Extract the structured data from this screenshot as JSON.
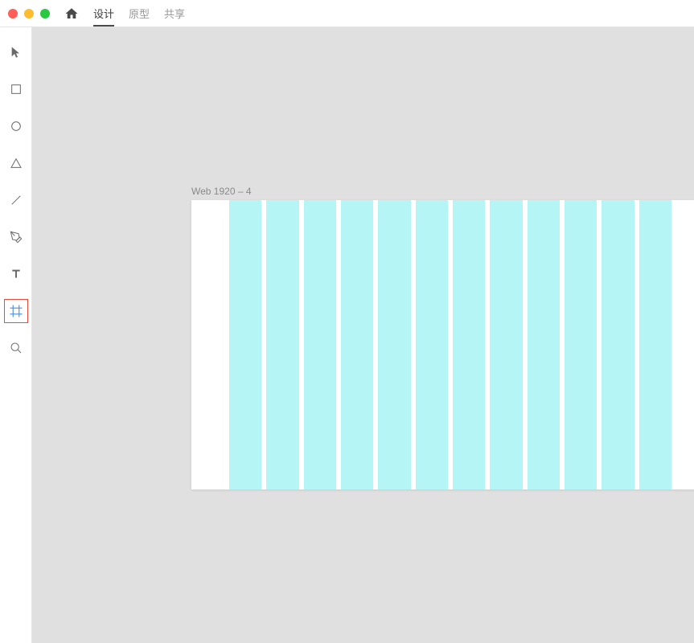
{
  "titlebar": {
    "tabs": [
      {
        "label": "设计",
        "active": true
      },
      {
        "label": "原型",
        "active": false
      },
      {
        "label": "共享",
        "active": false
      }
    ]
  },
  "toolbar": {
    "tools": [
      {
        "name": "select-tool",
        "icon": "select"
      },
      {
        "name": "rectangle-tool",
        "icon": "rectangle"
      },
      {
        "name": "ellipse-tool",
        "icon": "ellipse"
      },
      {
        "name": "triangle-tool",
        "icon": "triangle"
      },
      {
        "name": "line-tool",
        "icon": "line"
      },
      {
        "name": "pen-tool",
        "icon": "pen"
      },
      {
        "name": "text-tool",
        "icon": "text"
      },
      {
        "name": "artboard-tool",
        "icon": "artboard",
        "selected": true
      },
      {
        "name": "zoom-tool",
        "icon": "zoom"
      }
    ]
  },
  "canvas": {
    "artboard_label": "Web 1920 – 4",
    "column_count": 12,
    "column_color": "#b5f5f5"
  }
}
